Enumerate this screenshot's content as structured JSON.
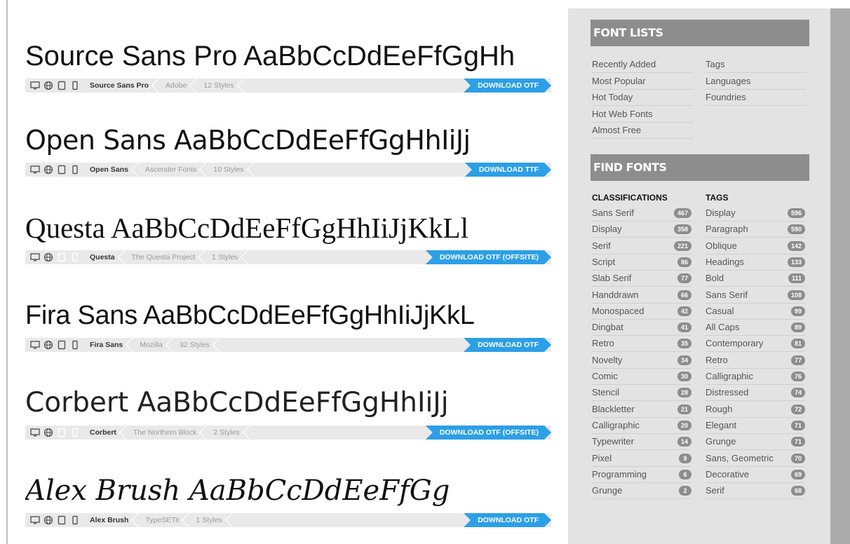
{
  "fonts": [
    {
      "name": "Source Sans Pro",
      "sample": "Source Sans Pro AaBbCcDdEeFfGgHh",
      "foundry": "Adobe",
      "styles": "12 Styles",
      "download": "DOWNLOAD OTF",
      "devices": [
        "desktop-icon",
        "web-icon",
        "tablet-icon",
        "phone-icon"
      ]
    },
    {
      "name": "Open Sans",
      "sample": "Open Sans AaBbCcDdEeFfGgHhIiJj",
      "foundry": "Ascender Fonts",
      "styles": "10 Styles",
      "download": "DOWNLOAD TTF",
      "devices": [
        "desktop-icon",
        "web-icon",
        "tablet-icon",
        "phone-icon"
      ]
    },
    {
      "name": "Questa",
      "sample": "Questa AaBbCcDdEeFfGgHhIiJjKkLl",
      "foundry": "The Questa Project",
      "styles": "1 Styles",
      "download": "DOWNLOAD OTF (OFFSITE)",
      "devices": [
        "desktop-icon",
        "web-icon"
      ]
    },
    {
      "name": "Fira Sans",
      "sample": "Fira Sans AaBbCcDdEeFfGgHhIiJjKkL",
      "foundry": "Mozilla",
      "styles": "32 Styles",
      "download": "DOWNLOAD OTF",
      "devices": [
        "desktop-icon",
        "web-icon",
        "tablet-icon",
        "phone-icon"
      ]
    },
    {
      "name": "Corbert",
      "sample": "Corbert AaBbCcDdEeFfGgHhIiJj",
      "foundry": "The Northern Block",
      "styles": "2 Styles",
      "download": "DOWNLOAD OTF (OFFSITE)",
      "devices": [
        "desktop-icon",
        "web-icon"
      ]
    },
    {
      "name": "Alex Brush",
      "sample": "Alex Brush AaBbCcDdEeFfGg",
      "foundry": "TypeSETit",
      "styles": "1 Styles",
      "download": "DOWNLOAD OTF",
      "devices": [
        "desktop-icon",
        "web-icon",
        "tablet-icon",
        "phone-icon"
      ]
    }
  ],
  "sidebar": {
    "font_lists_title": "FONT LISTS",
    "font_lists_left": [
      "Recently Added",
      "Most Popular",
      "Hot Today",
      "Hot Web Fonts",
      "Almost Free"
    ],
    "font_lists_right": [
      "Tags",
      "Languages",
      "Foundries"
    ],
    "find_fonts_title": "FIND FONTS",
    "classifications_title": "CLASSIFICATIONS",
    "tags_title": "TAGS",
    "classifications": [
      {
        "label": "Sans Serif",
        "count": "467"
      },
      {
        "label": "Display",
        "count": "358"
      },
      {
        "label": "Serif",
        "count": "221"
      },
      {
        "label": "Script",
        "count": "86"
      },
      {
        "label": "Slab Serif",
        "count": "77"
      },
      {
        "label": "Handdrawn",
        "count": "66"
      },
      {
        "label": "Monospaced",
        "count": "42"
      },
      {
        "label": "Dingbat",
        "count": "41"
      },
      {
        "label": "Retro",
        "count": "35"
      },
      {
        "label": "Novelty",
        "count": "34"
      },
      {
        "label": "Comic",
        "count": "30"
      },
      {
        "label": "Stencil",
        "count": "28"
      },
      {
        "label": "Blackletter",
        "count": "21"
      },
      {
        "label": "Calligraphic",
        "count": "20"
      },
      {
        "label": "Typewriter",
        "count": "14"
      },
      {
        "label": "Pixel",
        "count": "9"
      },
      {
        "label": "Programming",
        "count": "6"
      },
      {
        "label": "Grunge",
        "count": "2"
      }
    ],
    "tags": [
      {
        "label": "Display",
        "count": "596"
      },
      {
        "label": "Paragraph",
        "count": "590"
      },
      {
        "label": "Oblique",
        "count": "142"
      },
      {
        "label": "Headings",
        "count": "133"
      },
      {
        "label": "Bold",
        "count": "111"
      },
      {
        "label": "Sans Serif",
        "count": "108"
      },
      {
        "label": "Casual",
        "count": "99"
      },
      {
        "label": "All Caps",
        "count": "89"
      },
      {
        "label": "Contemporary",
        "count": "81"
      },
      {
        "label": "Retro",
        "count": "77"
      },
      {
        "label": "Calligraphic",
        "count": "76"
      },
      {
        "label": "Distressed",
        "count": "74"
      },
      {
        "label": "Rough",
        "count": "72"
      },
      {
        "label": "Elegant",
        "count": "71"
      },
      {
        "label": "Grunge",
        "count": "71"
      },
      {
        "label": "Sans, Geometric",
        "count": "70"
      },
      {
        "label": "Decorative",
        "count": "69"
      },
      {
        "label": "Serif",
        "count": "68"
      }
    ]
  }
}
